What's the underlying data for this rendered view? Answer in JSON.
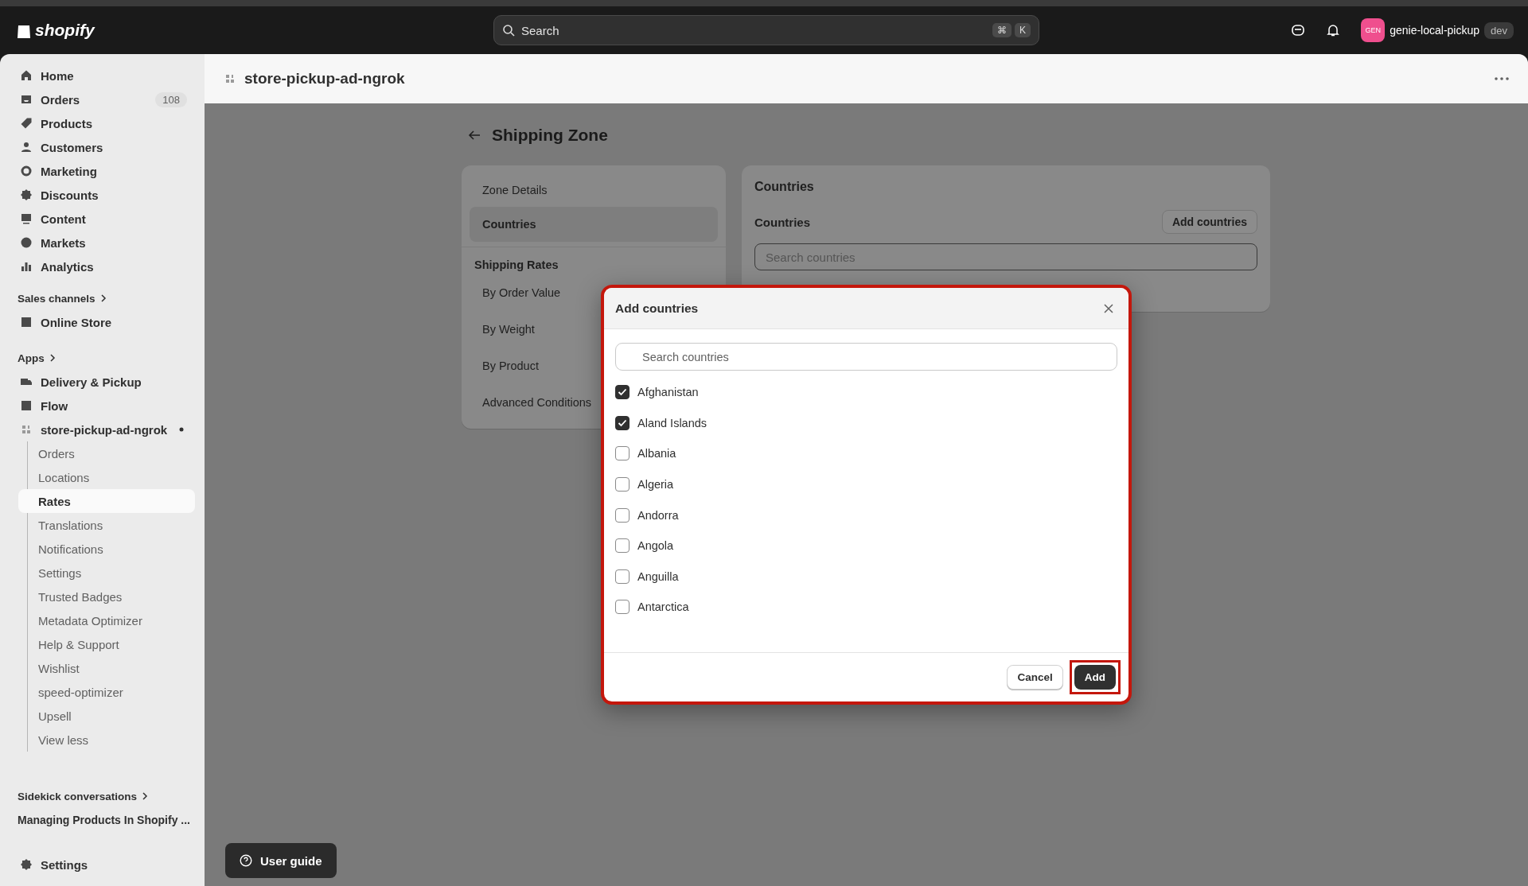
{
  "topbar": {
    "logo": "shopify",
    "search": {
      "placeholder": "Search",
      "keys": [
        "⌘",
        "K"
      ]
    },
    "store": {
      "badge": "GEN",
      "name": "genie-local-pickup",
      "tag": "dev"
    }
  },
  "sidebar": {
    "main_items": [
      {
        "label": "Home",
        "selected": false
      },
      {
        "label": "Orders",
        "selected": false,
        "count": "108"
      },
      {
        "label": "Products",
        "selected": false
      },
      {
        "label": "Customers",
        "selected": false
      },
      {
        "label": "Marketing",
        "selected": false
      },
      {
        "label": "Discounts",
        "selected": false
      },
      {
        "label": "Content",
        "selected": false
      },
      {
        "label": "Markets",
        "selected": false
      },
      {
        "label": "Analytics",
        "selected": false
      }
    ],
    "sales_channels": {
      "heading": "Sales channels",
      "items": [
        {
          "label": "Online Store",
          "selected": false
        }
      ]
    },
    "apps": {
      "heading": "Apps",
      "items": [
        {
          "label": "Delivery & Pickup",
          "selected": false
        },
        {
          "label": "Flow",
          "selected": false
        },
        {
          "label": "store-pickup-ad-ngrok",
          "selected": false,
          "pinned": true,
          "children": [
            {
              "label": "Orders",
              "selected": false
            },
            {
              "label": "Locations",
              "selected": false
            },
            {
              "label": "Rates",
              "selected": true
            },
            {
              "label": "Translations",
              "selected": false
            },
            {
              "label": "Notifications",
              "selected": false
            },
            {
              "label": "Settings",
              "selected": false
            },
            {
              "label": "Trusted Badges",
              "selected": false
            },
            {
              "label": "Metadata Optimizer",
              "selected": false
            },
            {
              "label": "Help & Support",
              "selected": false
            },
            {
              "label": "Wishlist",
              "selected": false
            },
            {
              "label": "speed-optimizer",
              "selected": false
            },
            {
              "label": "Upsell",
              "selected": false
            },
            {
              "label": "View less",
              "selected": false
            }
          ]
        }
      ]
    },
    "sidekick": {
      "heading": "Sidekick conversations",
      "items": [
        "Managing Products In Shopify ..."
      ]
    },
    "settings": "Settings"
  },
  "page": {
    "title": "store-pickup-ad-ngrok",
    "heading": "Shipping Zone",
    "nav": {
      "items": [
        {
          "label": "Zone Details",
          "selected": false
        },
        {
          "label": "Countries",
          "selected": true
        }
      ],
      "section": "Shipping Rates",
      "rate_items": [
        {
          "label": "By Order Value",
          "selected": false
        },
        {
          "label": "By Weight",
          "selected": false
        },
        {
          "label": "By Product",
          "selected": false
        },
        {
          "label": "Advanced Conditions",
          "selected": false
        }
      ]
    },
    "countries_card": {
      "title": "Countries",
      "subtitle": "Countries",
      "button": "Add countries",
      "search": {
        "placeholder": "Search countries"
      }
    }
  },
  "modal": {
    "title": "Add countries",
    "highlighted": true,
    "search": {
      "placeholder": "Search countries"
    },
    "countries": [
      {
        "name": "Afghanistan",
        "checked": true
      },
      {
        "name": "Aland Islands",
        "checked": true
      },
      {
        "name": "Albania",
        "checked": false
      },
      {
        "name": "Algeria",
        "checked": false
      },
      {
        "name": "Andorra",
        "checked": false
      },
      {
        "name": "Angola",
        "checked": false
      },
      {
        "name": "Anguilla",
        "checked": false
      },
      {
        "name": "Antarctica",
        "checked": false
      }
    ],
    "cancel": "Cancel",
    "add": {
      "label": "Add",
      "highlighted": true
    }
  },
  "user_guide": "User guide"
}
